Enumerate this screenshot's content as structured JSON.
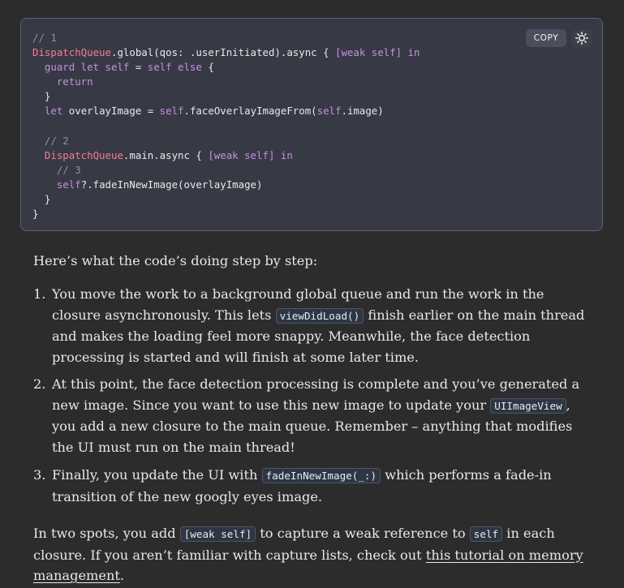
{
  "code": {
    "copy_label": "COPY",
    "theme_icon": "sun-icon",
    "lines": [
      [
        {
          "t": "// 1",
          "c": "comment"
        }
      ],
      [
        {
          "t": "DispatchQueue",
          "c": "type"
        },
        {
          "t": ".global(qos: .userInitiated).async { ",
          "c": "plain"
        },
        {
          "t": "[weak self]",
          "c": "kw"
        },
        {
          "t": " ",
          "c": "plain"
        },
        {
          "t": "in",
          "c": "kw"
        }
      ],
      [
        {
          "t": "  ",
          "c": "plain"
        },
        {
          "t": "guard let self",
          "c": "kw"
        },
        {
          "t": " = ",
          "c": "plain"
        },
        {
          "t": "self else",
          "c": "kw"
        },
        {
          "t": " {",
          "c": "plain"
        }
      ],
      [
        {
          "t": "    ",
          "c": "plain"
        },
        {
          "t": "return",
          "c": "kw"
        }
      ],
      [
        {
          "t": "  }",
          "c": "plain"
        }
      ],
      [
        {
          "t": "  ",
          "c": "plain"
        },
        {
          "t": "let",
          "c": "kw"
        },
        {
          "t": " overlayImage = ",
          "c": "plain"
        },
        {
          "t": "self",
          "c": "kw"
        },
        {
          "t": ".faceOverlayImageFrom(",
          "c": "plain"
        },
        {
          "t": "self",
          "c": "kw"
        },
        {
          "t": ".image)",
          "c": "plain"
        }
      ],
      [
        {
          "t": "",
          "c": "plain"
        }
      ],
      [
        {
          "t": "  ",
          "c": "plain"
        },
        {
          "t": "// 2",
          "c": "comment"
        }
      ],
      [
        {
          "t": "  ",
          "c": "plain"
        },
        {
          "t": "DispatchQueue",
          "c": "type"
        },
        {
          "t": ".main.async { ",
          "c": "plain"
        },
        {
          "t": "[weak self]",
          "c": "kw"
        },
        {
          "t": " ",
          "c": "plain"
        },
        {
          "t": "in",
          "c": "kw"
        }
      ],
      [
        {
          "t": "    ",
          "c": "plain"
        },
        {
          "t": "// 3",
          "c": "comment"
        }
      ],
      [
        {
          "t": "    ",
          "c": "plain"
        },
        {
          "t": "self",
          "c": "kw"
        },
        {
          "t": "?.fadeInNewImage(overlayImage)",
          "c": "plain"
        }
      ],
      [
        {
          "t": "  }",
          "c": "plain"
        }
      ],
      [
        {
          "t": "}",
          "c": "plain"
        }
      ]
    ]
  },
  "article": {
    "intro": "Here’s what the code’s doing step by step:",
    "steps": [
      {
        "number": "1.",
        "parts": [
          {
            "t": "You move the work to a background global queue and run the work in the closure asynchronously. This lets ",
            "k": "text"
          },
          {
            "t": "viewDidLoad()",
            "k": "code"
          },
          {
            "t": " finish earlier on the main thread and makes the loading feel more snappy. Meanwhile, the face detection processing is started and will finish at some later time.",
            "k": "text"
          }
        ]
      },
      {
        "number": "2.",
        "parts": [
          {
            "t": "At this point, the face detection processing is complete and you’ve generated a new image. Since you want to use this new image to update your ",
            "k": "text"
          },
          {
            "t": "UIImageView",
            "k": "code"
          },
          {
            "t": ", you add a new closure to the main queue. Remember – anything that modifies the UI must run on the main thread!",
            "k": "text"
          }
        ]
      },
      {
        "number": "3.",
        "parts": [
          {
            "t": "Finally, you update the UI with ",
            "k": "text"
          },
          {
            "t": "fadeInNewImage(_:)",
            "k": "code"
          },
          {
            "t": " which performs a fade-in transition of the new googly eyes image.",
            "k": "text"
          }
        ]
      }
    ],
    "outro": [
      {
        "t": "In two spots, you add ",
        "k": "text"
      },
      {
        "t": "[weak self]",
        "k": "code"
      },
      {
        "t": " to capture a weak reference to ",
        "k": "text"
      },
      {
        "t": "self",
        "k": "code"
      },
      {
        "t": " in each closure. If you aren’t familiar with capture lists, check out ",
        "k": "text"
      },
      {
        "t": "this tutorial on memory management",
        "k": "link"
      },
      {
        "t": ".",
        "k": "text"
      }
    ]
  }
}
